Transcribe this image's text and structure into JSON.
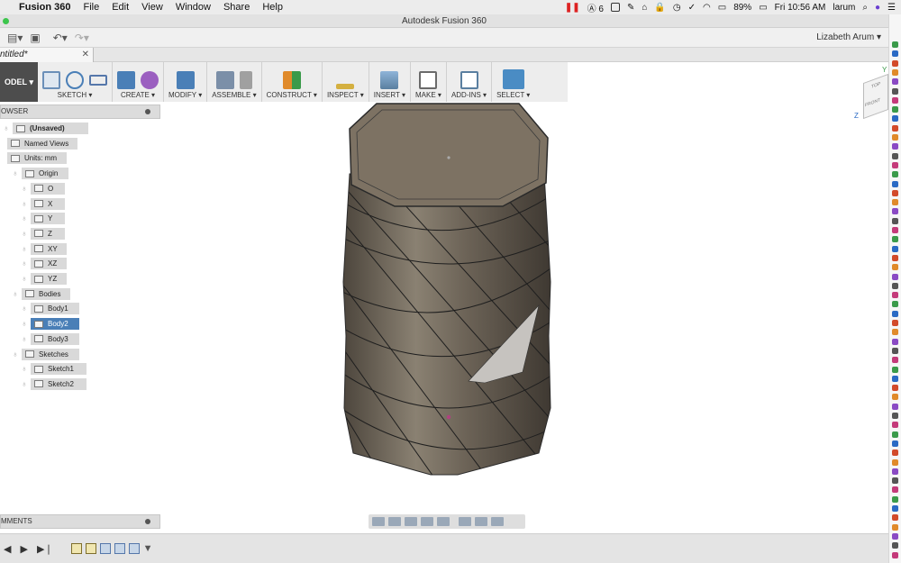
{
  "menubar": {
    "apple": "",
    "app_name": "Fusion 360",
    "items": [
      "File",
      "Edit",
      "View",
      "Window",
      "Share",
      "Help"
    ],
    "status": {
      "badge": "6",
      "battery": "89%",
      "clock": "Fri 10:56 AM",
      "user": "larum"
    }
  },
  "window": {
    "title": "Autodesk Fusion 360"
  },
  "quick_access": {
    "user": "Lizabeth Arum"
  },
  "document_tab": {
    "label": "ntitled*",
    "close": "✕"
  },
  "toolbar": {
    "workspace": "ODEL",
    "groups": [
      {
        "label": "SKETCH",
        "colors": [
          "#6b8fb8",
          "#4a7fb7",
          "#5577aa"
        ]
      },
      {
        "label": "CREATE",
        "colors": [
          "#4a7fb7",
          "#9b5fc0"
        ]
      },
      {
        "label": "MODIFY",
        "colors": [
          "#4a7fb7"
        ]
      },
      {
        "label": "ASSEMBLE",
        "colors": [
          "#7b8fa8",
          "#8a8a8a"
        ]
      },
      {
        "label": "CONSTRUCT",
        "colors": [
          "#e08a2a"
        ]
      },
      {
        "label": "INSPECT",
        "colors": [
          "#d4b040"
        ]
      },
      {
        "label": "INSERT",
        "colors": [
          "#5a7fa0"
        ]
      },
      {
        "label": "MAKE",
        "colors": [
          "#6a6a6a"
        ]
      },
      {
        "label": "ADD-INS",
        "colors": [
          "#5a7fa0"
        ]
      },
      {
        "label": "SELECT",
        "colors": [
          "#4a8cc4"
        ]
      }
    ]
  },
  "browser": {
    "title": "OWSER",
    "nodes": [
      {
        "label": "(Unsaved)"
      },
      {
        "label": "Named Views"
      },
      {
        "label": "Units: mm"
      },
      {
        "label": "Origin"
      },
      {
        "label": "O"
      },
      {
        "label": "X"
      },
      {
        "label": "Y"
      },
      {
        "label": "Z"
      },
      {
        "label": "XY"
      },
      {
        "label": "XZ"
      },
      {
        "label": "YZ"
      },
      {
        "label": "Bodies"
      },
      {
        "label": "Body1"
      },
      {
        "label": "Body2"
      },
      {
        "label": "Body3"
      },
      {
        "label": "Sketches"
      },
      {
        "label": "Sketch1"
      },
      {
        "label": "Sketch2"
      }
    ]
  },
  "comments": {
    "title": "MMENTS"
  },
  "viewcube": {
    "axis_y": "Y",
    "axis_z": "Z",
    "face_front": "FRONT",
    "face_top": "TOP"
  },
  "colors": {
    "body": "#6b6256",
    "body_dark": "#4a433a",
    "selected": "#4a7fb7",
    "background": "#ffffff"
  }
}
